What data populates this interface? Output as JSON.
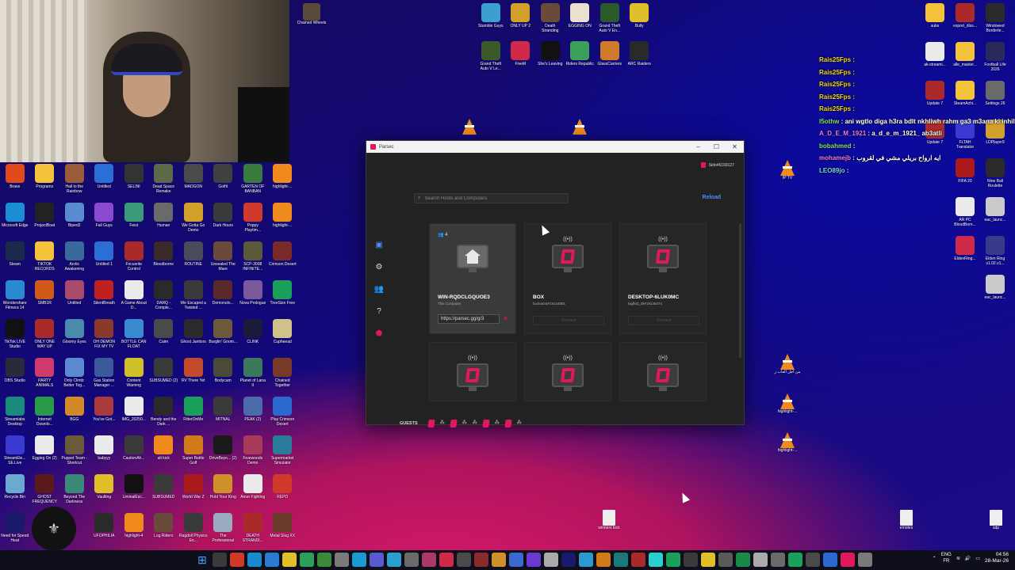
{
  "desktop": {
    "left_icons": [
      {
        "label": "Brave",
        "color": "#e04a1c"
      },
      {
        "label": "Programs",
        "color": "#f3c43a"
      },
      {
        "label": "Hail to the Rainbow",
        "color": "#9a5b3a"
      },
      {
        "label": "Untitled",
        "color": "#2b6fd6"
      },
      {
        "label": "SELINI",
        "color": "#333333"
      },
      {
        "label": "Dead Space Remake",
        "color": "#5b6b4a"
      },
      {
        "label": "MADGON",
        "color": "#4a4a4a"
      },
      {
        "label": "Golfit",
        "color": "#404040"
      },
      {
        "label": "GARTEN OF BANBAN",
        "color": "#3a7a3a"
      },
      {
        "label": "highlight-...",
        "color": "#f08a1c"
      },
      {
        "label": "Microsoft Edge",
        "color": "#1a8fd6"
      },
      {
        "label": "ProjectBoat",
        "color": "#222222"
      },
      {
        "label": "Biped2",
        "color": "#5a8ad0"
      },
      {
        "label": "Fall Guys",
        "color": "#8a4ad0"
      },
      {
        "label": "Feist",
        "color": "#3a9a7a"
      },
      {
        "label": "Human",
        "color": "#6a6a6a"
      },
      {
        "label": "We Gotta Go Demo",
        "color": "#d0a02a"
      },
      {
        "label": "Dark Hours",
        "color": "#3a3a3a"
      },
      {
        "label": "Poppy Playtim...",
        "color": "#d03a2a"
      },
      {
        "label": "highlight-...",
        "color": "#f08a1c"
      },
      {
        "label": "Steam",
        "color": "#1a2a4a"
      },
      {
        "label": "TIKTOK RECORDS",
        "color": "#f3c43a"
      },
      {
        "label": "Arctic Awakening",
        "color": "#3a6a9a"
      },
      {
        "label": "Untitled 1",
        "color": "#2b6fd6"
      },
      {
        "label": "Focusrite Control",
        "color": "#aa2a2a"
      },
      {
        "label": "Bloodborne",
        "color": "#3a2a2a"
      },
      {
        "label": "ROUTINE",
        "color": "#4a4a5a"
      },
      {
        "label": "Unsealed The Mare",
        "color": "#6a4a3a"
      },
      {
        "label": "SCP-3008 INFINITE...",
        "color": "#5a5a3a"
      },
      {
        "label": "Crimson Desert",
        "color": "#7a2a2a"
      },
      {
        "label": "Wondershare Filmora 14",
        "color": "#2a8ad0"
      },
      {
        "label": "SMB1R",
        "color": "#d05a1a"
      },
      {
        "label": "Untitled",
        "color": "#aa4a6a"
      },
      {
        "label": "SilentBreath",
        "color": "#c02020"
      },
      {
        "label": "A Game About D...",
        "color": "#eaeaea"
      },
      {
        "label": "DARQ - Comple...",
        "color": "#2a2a2a"
      },
      {
        "label": "We Escaped a Twisted ...",
        "color": "#3a3a3a"
      },
      {
        "label": "Demonolo...",
        "color": "#5a2a2a"
      },
      {
        "label": "Nova Prologue",
        "color": "#7a5a9a"
      },
      {
        "label": "TreeSize Free",
        "color": "#1aa05a"
      },
      {
        "label": "TikTok LIVE Studio",
        "color": "#111111"
      },
      {
        "label": "ONLY ONE WAY UP",
        "color": "#aa2a2a"
      },
      {
        "label": "Gloomy Eyes",
        "color": "#4a8aaa"
      },
      {
        "label": "OH DEMON FIX MY TV",
        "color": "#8a3a2a"
      },
      {
        "label": "BOTTLE CAN FLOAT",
        "color": "#3a8ad0"
      },
      {
        "label": "Caim",
        "color": "#4a4a4a"
      },
      {
        "label": "Ghost Janitors",
        "color": "#2a2a2a"
      },
      {
        "label": "Burglin' Gnom...",
        "color": "#6a5a3a"
      },
      {
        "label": "CLINK",
        "color": "#1a1a3a"
      },
      {
        "label": "Cupheead",
        "color": "#d0c08a"
      },
      {
        "label": "OBS Studio",
        "color": "#2a2a3a"
      },
      {
        "label": "PARTY ANIMALS",
        "color": "#d03a6a"
      },
      {
        "label": "Only Climb: Better Tog...",
        "color": "#5a8ad0"
      },
      {
        "label": "Gas Station Manager ...",
        "color": "#3a5a9a"
      },
      {
        "label": "Content Warning",
        "color": "#d0c02a"
      },
      {
        "label": "SUBSUMED (2)",
        "color": "#3a3a3a"
      },
      {
        "label": "RV There Yet",
        "color": "#c04a2a"
      },
      {
        "label": "Bodycam",
        "color": "#4a4a3a"
      },
      {
        "label": "Planet of Lana II",
        "color": "#3a7a5a"
      },
      {
        "label": "Chained Together",
        "color": "#7a3a2a"
      },
      {
        "label": "Streamlabs Desktop",
        "color": "#1a8a7a"
      },
      {
        "label": "Internet Downlo...",
        "color": "#2a9a4a"
      },
      {
        "label": "BGG",
        "color": "#d08a2a"
      },
      {
        "label": "You've Got...",
        "color": "#aa3a3a"
      },
      {
        "label": "IMG_20250...",
        "color": "#eaeaea"
      },
      {
        "label": "Bendy and the Dark ...",
        "color": "#2a2a2a"
      },
      {
        "label": "FitterOnMe",
        "color": "#1aa05a"
      },
      {
        "label": "MITNAL",
        "color": "#3a3a3a"
      },
      {
        "label": "PEAK (2)",
        "color": "#4a6aaa"
      },
      {
        "label": "Play Crimson Desert",
        "color": "#2a6ad0"
      },
      {
        "label": "StreamEle... SE.Live",
        "color": "#3a3ad0"
      },
      {
        "label": "Egging On (2)",
        "color": "#eaeaea"
      },
      {
        "label": "Puppet Team - Shortcut",
        "color": "#6a5a3a"
      },
      {
        "label": "babyyy",
        "color": "#eaeaea"
      },
      {
        "label": "CautionAh...",
        "color": "#3a3a3a"
      },
      {
        "label": "alt kick",
        "color": "#f08a1c"
      },
      {
        "label": "Super Battle Golf",
        "color": "#d07a1a"
      },
      {
        "label": "DriveBeyo... (2)",
        "color": "#1a1a1a"
      },
      {
        "label": "Fearwoods Demo",
        "color": "#aa3a5a"
      },
      {
        "label": "Supermarket Simulator",
        "color": "#2a7a9a"
      },
      {
        "label": "Recycle Bin",
        "color": "#6aaad0"
      },
      {
        "label": "GHOST FREQUENCY",
        "color": "#5a1a1a"
      },
      {
        "label": "Beyond The Darkness",
        "color": "#3a8a7a"
      },
      {
        "label": "Vaulting",
        "color": "#e0c02a"
      },
      {
        "label": "LiminalEsc...",
        "color": "#111111"
      },
      {
        "label": "SUBSUMED",
        "color": "#3a3a3a"
      },
      {
        "label": "World War Z",
        "color": "#aa1a1a"
      },
      {
        "label": "Hold Your King",
        "color": "#d0902a"
      },
      {
        "label": "Amer Fighting",
        "color": "#eaeaea"
      },
      {
        "label": "REPO",
        "color": "#d03a2a"
      },
      {
        "label": "Need for Speed Heat",
        "color": "#1a1a6a"
      },
      {
        "label": "",
        "color": "#121212"
      },
      {
        "label": "",
        "color": "#d0a02a"
      },
      {
        "label": "UFOPHILIA",
        "color": "#2a2a2a"
      },
      {
        "label": "highlight-4",
        "color": "#f08a1c"
      },
      {
        "label": "Log Riders",
        "color": "#6a4a3a"
      },
      {
        "label": "Ragdoll Physics En...",
        "color": "#3a3a3a"
      },
      {
        "label": "The Professional",
        "color": "#9aaac0"
      },
      {
        "label": "DEATH STRANDI...",
        "color": "#aa2a2a"
      },
      {
        "label": "Metal Slug XX",
        "color": "#6a3a2a"
      }
    ],
    "top_icons": [
      {
        "label": "Stumble Guys",
        "color": "#3aa0d0"
      },
      {
        "label": "ONLY UP 2",
        "color": "#d0a02a"
      },
      {
        "label": "Death Stranding",
        "color": "#6a4a3a"
      },
      {
        "label": "EGGING ON",
        "color": "#eae0d0"
      },
      {
        "label": "Grand Theft Auto V En...",
        "color": "#2a5a2a"
      },
      {
        "label": "Bully",
        "color": "#e0c02a"
      },
      {
        "label": "Grand Theft Auto V Le...",
        "color": "#3a5a2a"
      },
      {
        "label": "FiveM",
        "color": "#d02a4a"
      },
      {
        "label": "She's Leaving",
        "color": "#111111"
      },
      {
        "label": "Riders Republic",
        "color": "#3aa05a"
      },
      {
        "label": "GlassCarriers",
        "color": "#d07a2a"
      },
      {
        "label": "ARC Raiders",
        "color": "#2a2a2a"
      }
    ],
    "right_icons": [
      {
        "label": "subs",
        "color": "#f3c43a"
      },
      {
        "label": "export_dlss...",
        "color": "#aa2a2a"
      },
      {
        "label": "Windowed Borderle...",
        "color": "#2a2a2a"
      },
      {
        "label": "ak-streami...",
        "color": "#eaeaea"
      },
      {
        "label": "alle_master...",
        "color": "#f3c43a"
      },
      {
        "label": "Football Life 2026",
        "color": "#2a2a5a"
      },
      {
        "label": "Update 7",
        "color": "#aa2a2a"
      },
      {
        "label": "SteamAchi...",
        "color": "#f3c43a"
      },
      {
        "label": "Settings 26",
        "color": "#6a6a6a"
      },
      {
        "label": "Update 7",
        "color": "#aa2a2a"
      },
      {
        "label": "FLTAH Translator",
        "color": "#3a3ad0"
      },
      {
        "label": "LDPlayer9",
        "color": "#d0a02a"
      },
      {
        "label": "",
        "color": "#000000"
      },
      {
        "label": "FIFA 20",
        "color": "#aa1a1a"
      },
      {
        "label": "Nine Ball Roulette",
        "color": "#2a2a2a"
      },
      {
        "label": "",
        "color": "#000000"
      },
      {
        "label": "AR PC BloodBorn...",
        "color": "#eaeaea"
      },
      {
        "label": "eac_launc...",
        "color": "#cacaca"
      },
      {
        "label": "",
        "color": "#000000"
      },
      {
        "label": "EldenRing...",
        "color": "#d02a4a"
      },
      {
        "label": "Elden Ring v1.02.v1...",
        "color": "#3a3a8a"
      },
      {
        "label": "",
        "color": "#000000"
      },
      {
        "label": "",
        "color": "#000000"
      },
      {
        "label": "eac_launc...",
        "color": "#cacaca"
      }
    ],
    "loose": {
      "chained_wheels": "Chained Wheels",
      "ip_tv": "IP TV",
      "arabic_shortcut": "من أجل ألعاب ز",
      "highlight_a": "highlight-...",
      "highlight_b": "highlight-...",
      "winners_kick": "winners kick",
      "emotes": "emotes",
      "sdp": "sdp"
    }
  },
  "chat": {
    "lines": [
      {
        "user": "Rais25Fps :",
        "text": "",
        "ucolor": "u-yellow"
      },
      {
        "user": "Rais25Fps :",
        "text": "",
        "ucolor": "u-yellow"
      },
      {
        "user": "Rais25Fps :",
        "text": "",
        "ucolor": "u-yellow"
      },
      {
        "user": "Rais25Fps :",
        "text": "",
        "ucolor": "u-yellow"
      },
      {
        "user": "Rais25Fps :",
        "text": "",
        "ucolor": "u-yellow"
      },
      {
        "user": "I5othw",
        "text": ": ani wgtlo diga h3ra bdlt nkhliwh rahm ga3 m3ana ki inhilo",
        "ucolor": "u-green"
      },
      {
        "user": "A_D_E_M_1921",
        "text": ": a_d_e_m_1921_ ab3atli",
        "ucolor": "u-pink"
      },
      {
        "user": "bobahmed",
        "text": ":",
        "ucolor": "u-green"
      },
      {
        "user": "mohamejb",
        "text": ": ايه ارواح بريلي مشي في لقروب",
        "ucolor": "u-pink"
      },
      {
        "user": "LEO89jo",
        "text": ":",
        "ucolor": "u-cyan"
      }
    ]
  },
  "parsec": {
    "window_title": "Parsec",
    "user_id": "Sido#6169127",
    "search_placeholder": "Search Hosts and Computers",
    "reload_label": "Reload",
    "guests_label": "GUESTS",
    "cards": [
      {
        "name": "WIN-RQDCLGQUOE3",
        "sub": "This Computer",
        "badge": "4",
        "link": "https://parsec.gg/g/3",
        "type": "home"
      },
      {
        "name": "BOX",
        "sub": "boxkarira#19144901",
        "button": "Connect",
        "type": "remote"
      },
      {
        "name": "DESKTOP-6LUK0MC",
        "sub": "lagfkld_39#19145474",
        "button": "Connect",
        "type": "remote"
      }
    ],
    "accent": "#e0185e",
    "link_blue": "#4c8dff"
  },
  "taskbar": {
    "time": "04:56",
    "date": "28-Mar-26",
    "lang_top": "ENG",
    "lang_bottom": "FR"
  }
}
